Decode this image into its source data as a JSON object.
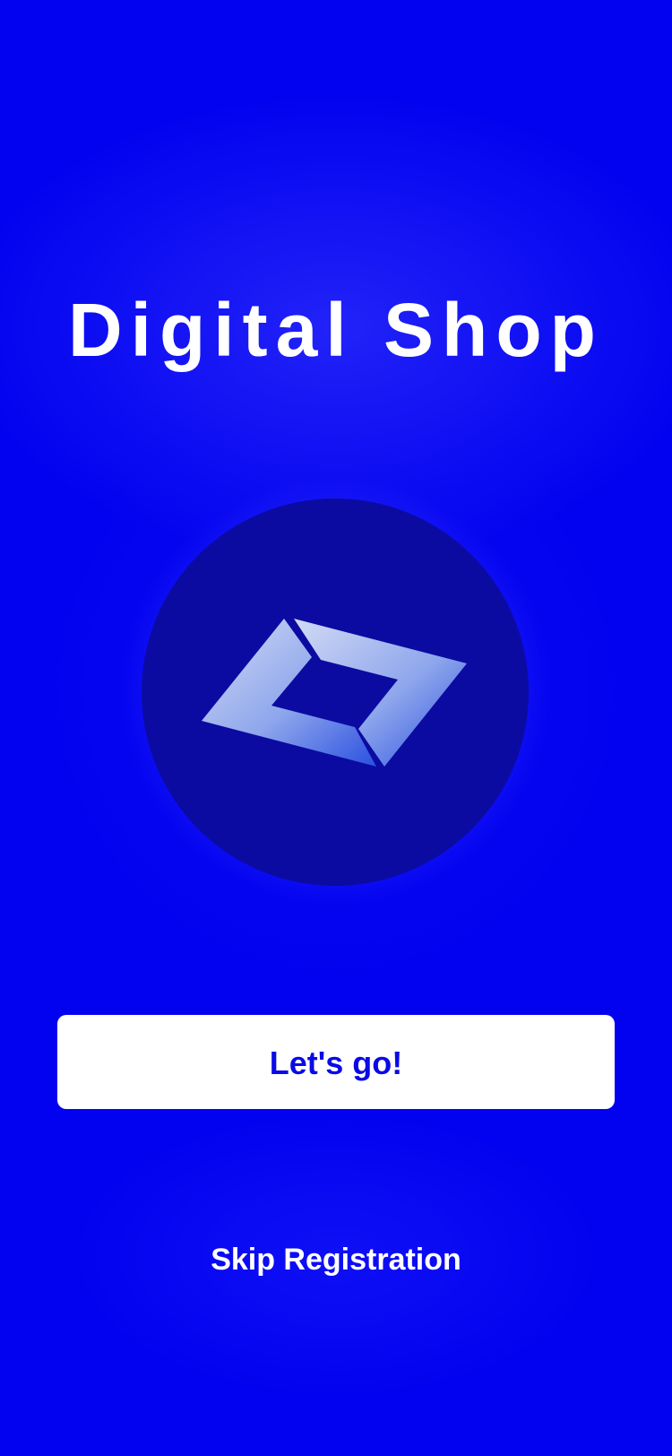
{
  "app": {
    "title": "Digital Shop"
  },
  "logo": {
    "icon": "shop-diamond-logo-icon",
    "circle_color": "#0B0BA1",
    "gradient_start": "#C9D2F2",
    "gradient_end": "#2F55E2"
  },
  "actions": {
    "primary_label": "Let's go!",
    "skip_label": "Skip Registration"
  },
  "colors": {
    "background": "#0202F0",
    "button_background": "#FFFFFF",
    "button_text": "#0A0AE6",
    "text": "#FFFFFF"
  }
}
